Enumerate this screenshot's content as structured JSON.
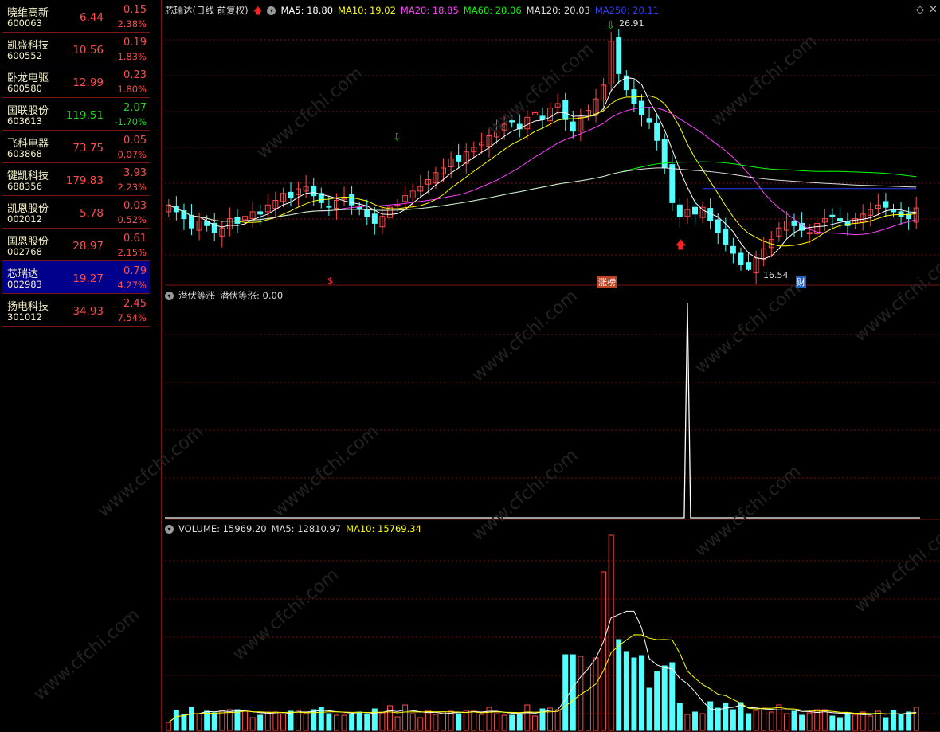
{
  "watchlist": [
    {
      "name": "晓维高新",
      "code": "600063",
      "price": "6.44",
      "change": "0.15",
      "pct": "2.38%",
      "dir": "up"
    },
    {
      "name": "凯盛科技",
      "code": "600552",
      "price": "10.56",
      "change": "0.19",
      "pct": "1.83%",
      "dir": "up"
    },
    {
      "name": "卧龙电驱",
      "code": "600580",
      "price": "12.99",
      "change": "0.23",
      "pct": "1.80%",
      "dir": "up"
    },
    {
      "name": "国联股份",
      "code": "603613",
      "price": "119.51",
      "change": "-2.07",
      "pct": "-1.70%",
      "dir": "dn"
    },
    {
      "name": "飞科电器",
      "code": "603868",
      "price": "73.75",
      "change": "0.05",
      "pct": "0.07%",
      "dir": "up"
    },
    {
      "name": "键凯科技",
      "code": "688356",
      "price": "179.83",
      "change": "3.93",
      "pct": "2.23%",
      "dir": "up"
    },
    {
      "name": "凯恩股份",
      "code": "002012",
      "price": "5.78",
      "change": "0.03",
      "pct": "0.52%",
      "dir": "up"
    },
    {
      "name": "国恩股份",
      "code": "002768",
      "price": "28.97",
      "change": "0.61",
      "pct": "2.15%",
      "dir": "up"
    },
    {
      "name": "芯瑞达",
      "code": "002983",
      "price": "19.27",
      "change": "0.79",
      "pct": "4.27%",
      "dir": "up",
      "selected": true
    },
    {
      "name": "扬电科技",
      "code": "301012",
      "price": "34.93",
      "change": "2.45",
      "pct": "7.54%",
      "dir": "up"
    }
  ],
  "main_panel": {
    "title": "芯瑞达(日线 前复权)",
    "ma": [
      {
        "label": "MA5: 18.80",
        "color": "#ffffff"
      },
      {
        "label": "MA10: 19.02",
        "color": "#ffff00"
      },
      {
        "label": "MA20: 18.85",
        "color": "#ff40ff"
      },
      {
        "label": "MA60: 20.06",
        "color": "#00ff00"
      },
      {
        "label": "MA120: 20.03",
        "color": "#dddddd"
      },
      {
        "label": "MA250: 20.11",
        "color": "#2b3bff"
      }
    ],
    "high_label": "26.91",
    "low_label": "16.54",
    "markers": [
      "$",
      "涨榜",
      "财"
    ]
  },
  "indicator_panel": {
    "title": "潜伏等涨",
    "value_label": "潜伏等涨: 0.00"
  },
  "volume_panel": {
    "volume_label": "VOLUME: 15969.20",
    "ma5_label": "MA5: 12810.97",
    "ma10_label": "MA10: 15769.34"
  },
  "watermark": "www.cfchi.com",
  "colors": {
    "up": "#ff4b4b",
    "down": "#54ffff",
    "grid": "#7a1515",
    "selected": "#00008c"
  },
  "chart_data": {
    "type": "candlestick",
    "closes": [
      19.4,
      19.1,
      18.8,
      18.4,
      18.7,
      18.5,
      18.2,
      18.4,
      18.8,
      18.6,
      18.9,
      19.1,
      19.0,
      19.4,
      19.6,
      19.9,
      19.7,
      20.1,
      20.2,
      19.8,
      19.5,
      19.3,
      19.6,
      19.7,
      19.4,
      19.2,
      18.9,
      18.6,
      18.9,
      19.3,
      19.4,
      19.8,
      20.0,
      20.2,
      20.5,
      20.8,
      21.0,
      21.4,
      21.3,
      21.7,
      21.9,
      22.1,
      22.4,
      22.6,
      22.9,
      23.0,
      22.7,
      23.2,
      23.4,
      23.1,
      23.6,
      23.8,
      23.1,
      22.6,
      23.2,
      23.5,
      24.0,
      24.6,
      26.5,
      25.1,
      24.4,
      23.8,
      23.3,
      23.0,
      22.2,
      21.0,
      19.5,
      18.9,
      19.2,
      19.0,
      19.3,
      18.7,
      18.2,
      17.7,
      17.3,
      16.8,
      16.6,
      17.1,
      17.5,
      17.9,
      18.4,
      18.7,
      18.5,
      18.3,
      18.2,
      18.6,
      18.8,
      18.9,
      18.7,
      18.5,
      18.8,
      19.0,
      19.2,
      19.4,
      19.3,
      19.1,
      18.9,
      18.8,
      19.27
    ],
    "high": "26.91",
    "low": "16.54",
    "indicator_spike_index": 68
  }
}
